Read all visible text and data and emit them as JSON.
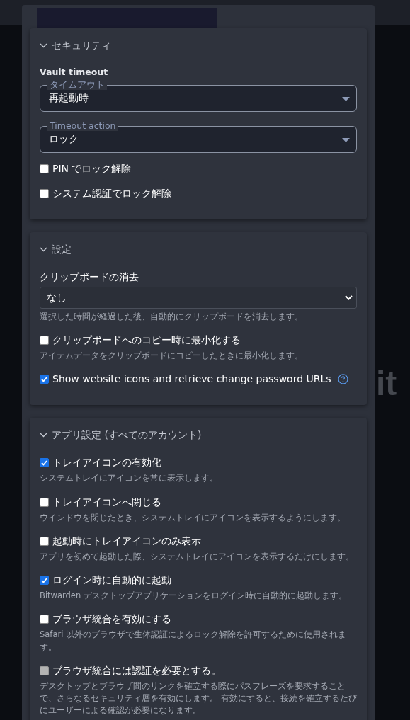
{
  "backdrop": {
    "logo_text": "it"
  },
  "sections": [
    {
      "title": "セキュリティ",
      "expanded": true,
      "items": [
        {
          "kind": "heading",
          "label": "Vault timeout"
        },
        {
          "kind": "outlined-select",
          "label": "タイムアウト",
          "value": "再起動時"
        },
        {
          "kind": "outlined-select",
          "label": "Timeout action",
          "value": "ロック"
        },
        {
          "kind": "checkbox",
          "label": "PIN でロック解除",
          "checked": false,
          "disabled": false
        },
        {
          "kind": "checkbox",
          "label": "システム認証でロック解除",
          "checked": false,
          "disabled": false
        }
      ]
    },
    {
      "title": "設定",
      "expanded": true,
      "items": [
        {
          "kind": "select",
          "label": "クリップボードの消去",
          "value": "なし",
          "description": "選択した時間が経過した後、自動的にクリップボードを消去します。"
        },
        {
          "kind": "checkbox",
          "label": "クリップボードへのコピー時に最小化する",
          "checked": false,
          "disabled": false,
          "description": "アイテムデータをクリップボードにコピーしたときに最小化します。"
        },
        {
          "kind": "checkbox",
          "label": "Show website icons and retrieve change password URLs",
          "checked": true,
          "disabled": false,
          "help": true
        }
      ]
    },
    {
      "title": "アプリ設定 (すべてのアカウント)",
      "expanded": true,
      "items": [
        {
          "kind": "checkbox",
          "label": "トレイアイコンの有効化",
          "checked": true,
          "disabled": false,
          "description": "システムトレイにアイコンを常に表示します。"
        },
        {
          "kind": "checkbox",
          "label": "トレイアイコンへ閉じる",
          "checked": false,
          "disabled": false,
          "description": "ウインドウを閉じたとき、システムトレイにアイコンを表示するようにします。"
        },
        {
          "kind": "checkbox",
          "label": "起動時にトレイアイコンのみ表示",
          "checked": false,
          "disabled": false,
          "description": "アプリを初めて起動した際、システムトレイにアイコンを表示するだけにします。"
        },
        {
          "kind": "checkbox",
          "label": "ログイン時に自動的に起動",
          "checked": true,
          "disabled": false,
          "description": "Bitwarden デスクトップアプリケーションをログイン時に自動的に起動します。"
        },
        {
          "kind": "checkbox",
          "label": "ブラウザ統合を有効にする",
          "checked": false,
          "disabled": false,
          "description": "Safari 以外のブラウザで生体認証によるロック解除を許可するために使用されます。"
        },
        {
          "kind": "checkbox",
          "label": "ブラウザ統合には認証を必要とする。",
          "checked": false,
          "disabled": true,
          "description": "デスクトップとブラウザ間のリンクを確立する際にパスフレーズを要求することで、さらなるセキュリティ層を有効にします。 有効にすると、接続を確立するたびにユーザーによる確認が必要になります。"
        }
      ]
    }
  ]
}
